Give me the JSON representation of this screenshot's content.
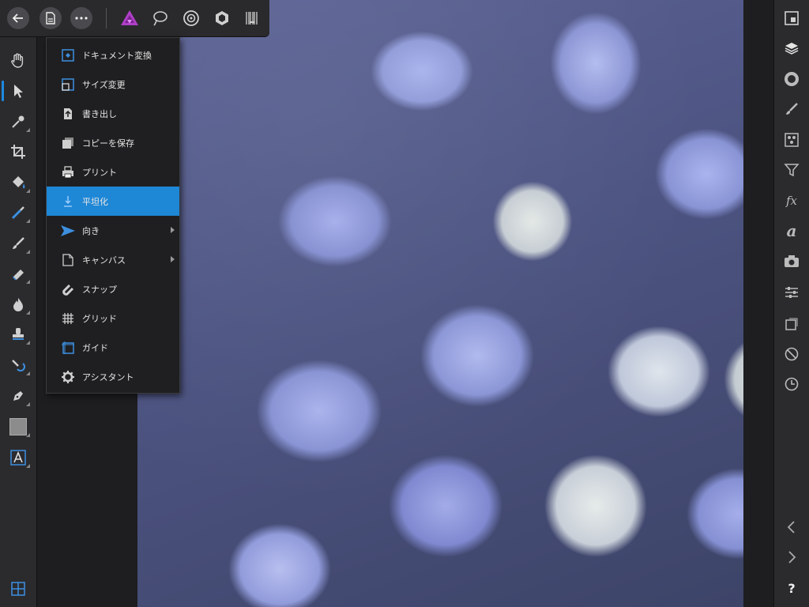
{
  "top_bar": {
    "icons": [
      "back-icon",
      "document-icon",
      "more-icon",
      "affinity-photo-persona-icon",
      "liquify-persona-icon",
      "develop-persona-icon",
      "tone-mapping-persona-icon",
      "export-persona-icon"
    ]
  },
  "document_menu": {
    "items": [
      {
        "label": "ドキュメント変換",
        "icon": "convert-document-icon",
        "submenu": false
      },
      {
        "label": "サイズ変更",
        "icon": "resize-icon",
        "submenu": false
      },
      {
        "label": "書き出し",
        "icon": "export-icon",
        "submenu": false
      },
      {
        "label": "コピーを保存",
        "icon": "save-copy-icon",
        "submenu": false
      },
      {
        "label": "プリント",
        "icon": "print-icon",
        "submenu": false
      },
      {
        "label": "平坦化",
        "icon": "flatten-icon",
        "submenu": false,
        "highlighted": true
      },
      {
        "label": "向き",
        "icon": "orientation-icon",
        "submenu": true
      },
      {
        "label": "キャンバス",
        "icon": "canvas-icon",
        "submenu": true
      },
      {
        "label": "スナップ",
        "icon": "snap-magnet-icon",
        "submenu": false
      },
      {
        "label": "グリッド",
        "icon": "grid-icon",
        "submenu": false
      },
      {
        "label": "ガイド",
        "icon": "guides-icon",
        "submenu": false
      },
      {
        "label": "アシスタント",
        "icon": "assistant-gear-icon",
        "submenu": false
      }
    ]
  },
  "left_toolbar": {
    "tools": [
      "hand-tool-icon",
      "move-tool-icon",
      "color-picker-icon",
      "crop-tool-icon",
      "flood-fill-icon",
      "selection-brush-icon",
      "paint-brush-icon",
      "erase-brush-icon",
      "dodge-burn-icon",
      "clone-stamp-icon",
      "healing-brush-icon",
      "pen-tool-icon",
      "rectangle-shape-icon",
      "text-tool-icon",
      "studio-layout-icon"
    ],
    "selected": "move-tool-icon"
  },
  "right_panel": {
    "tools": [
      "navigator-icon",
      "layers-icon",
      "color-icon",
      "brushes-icon",
      "channels-icon",
      "filter-funnel-icon",
      "fx-icon",
      "text-style-icon",
      "camera-icon",
      "adjustments-icon",
      "transform-icon",
      "history-prohibit-icon",
      "clock-icon",
      "undo-chevron-left-icon",
      "redo-chevron-right-icon",
      "help-icon"
    ],
    "help_label": "?"
  },
  "colors": {
    "accent": "#1e87d6",
    "panel": "#2b2b2e",
    "menu_bg": "#1f1f21"
  }
}
